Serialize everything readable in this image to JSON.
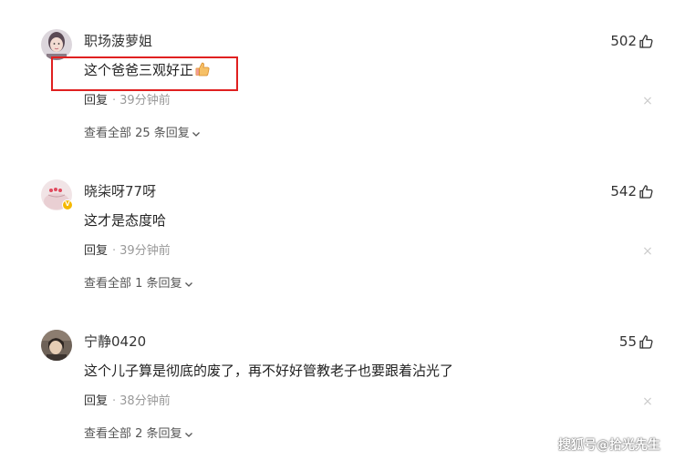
{
  "comments": [
    {
      "username": "职场菠萝姐",
      "likes": "502",
      "content": "这个爸爸三观好正",
      "reply_label": "回复",
      "dot": "·",
      "time": "39分钟前",
      "view_all": "查看全部 25 条回复",
      "avatar_icon": "avatar-woman-photo"
    },
    {
      "username": "晓柒呀77呀",
      "likes": "542",
      "content": "这才是态度哈",
      "reply_label": "回复",
      "dot": "·",
      "time": "39分钟前",
      "view_all": "查看全部 1 条回复",
      "avatar_icon": "avatar-hearts-photo",
      "badge": "V"
    },
    {
      "username": "宁静0420",
      "likes": "55",
      "content": "这个儿子算是彻底的废了，再不好好管教老子也要跟着沾光了",
      "reply_label": "回复",
      "dot": "·",
      "time": "38分钟前",
      "view_all": "查看全部 2 条回复",
      "avatar_icon": "avatar-portrait-photo"
    }
  ],
  "close_symbol": "×",
  "watermark": "搜狐号@拾光先生",
  "colors": {
    "highlight_border": "#e02020",
    "badge": "#f5b800",
    "muted": "#999999"
  }
}
